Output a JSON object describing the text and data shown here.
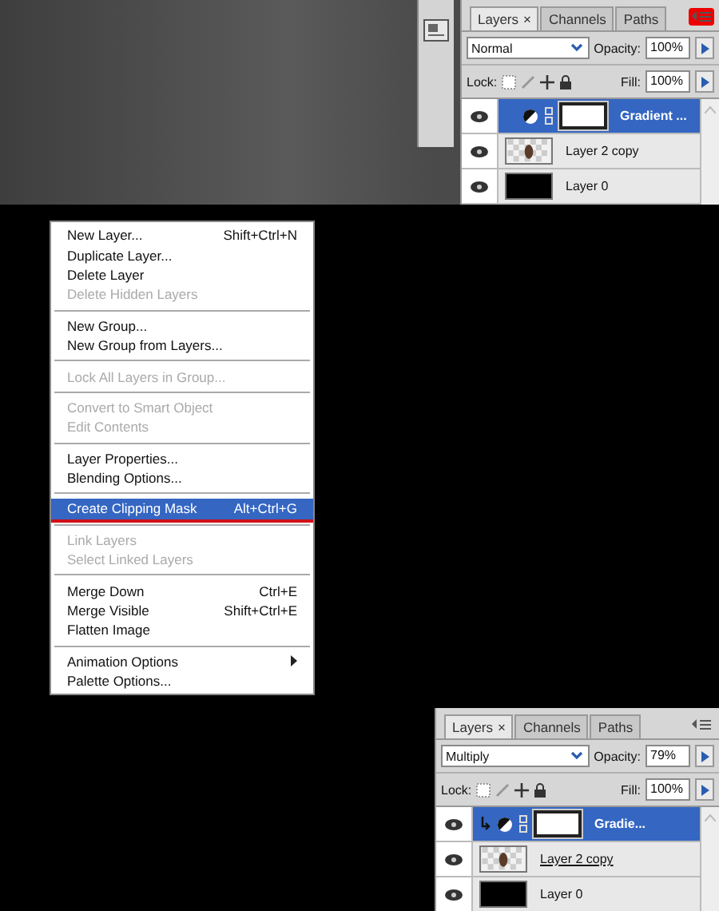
{
  "panels": [
    {
      "tabs": [
        {
          "label": "Layers",
          "selected": true,
          "close": "×"
        },
        {
          "label": "Channels",
          "selected": false
        },
        {
          "label": "Paths",
          "selected": false
        }
      ],
      "menu_button_marked": true,
      "blend_mode": "Normal",
      "opacity_label": "Opacity:",
      "opacity": "100%",
      "lock_label": "Lock:",
      "fill_label": "Fill:",
      "fill": "100%",
      "layers": [
        {
          "name": "Gradient ...",
          "kind": "adjustment",
          "selected": true,
          "clipped": false,
          "underlined": false
        },
        {
          "name": "Layer 2 copy",
          "kind": "image",
          "selected": false,
          "underlined": false
        },
        {
          "name": "Layer 0",
          "kind": "black",
          "selected": false,
          "underlined": false
        }
      ]
    },
    {
      "tabs": [
        {
          "label": "Layers",
          "selected": true,
          "close": "×"
        },
        {
          "label": "Channels",
          "selected": false
        },
        {
          "label": "Paths",
          "selected": false
        }
      ],
      "menu_button_marked": false,
      "blend_mode": "Multiply",
      "opacity_label": "Opacity:",
      "opacity": "79%",
      "lock_label": "Lock:",
      "fill_label": "Fill:",
      "fill": "100%",
      "layers": [
        {
          "name": "Gradie...",
          "kind": "adjustment",
          "selected": true,
          "clipped": true,
          "underlined": false
        },
        {
          "name": "Layer 2 copy",
          "kind": "image",
          "selected": false,
          "underlined": true
        },
        {
          "name": "Layer 0",
          "kind": "black",
          "selected": false,
          "underlined": false
        }
      ]
    }
  ],
  "context_menu": {
    "sections": [
      [
        {
          "label": "New Layer...",
          "shortcut": "Shift+Ctrl+N",
          "disabled": false,
          "selected": false
        },
        {
          "label": "Duplicate Layer...",
          "disabled": false,
          "selected": false
        },
        {
          "label": "Delete Layer",
          "disabled": false,
          "selected": false
        },
        {
          "label": "Delete Hidden Layers",
          "disabled": true,
          "selected": false
        }
      ],
      [
        {
          "label": "New Group...",
          "disabled": false,
          "selected": false
        },
        {
          "label": "New Group from Layers...",
          "disabled": false,
          "selected": false
        }
      ],
      [
        {
          "label": "Lock All Layers in Group...",
          "disabled": true,
          "selected": false
        }
      ],
      [
        {
          "label": "Convert to Smart Object",
          "disabled": true,
          "selected": false
        },
        {
          "label": "Edit Contents",
          "disabled": true,
          "selected": false
        }
      ],
      [
        {
          "label": "Layer Properties...",
          "disabled": false,
          "selected": false
        },
        {
          "label": "Blending Options...",
          "disabled": false,
          "selected": false
        }
      ],
      [
        {
          "label": "Create Clipping Mask",
          "shortcut": "Alt+Ctrl+G",
          "disabled": false,
          "selected": true
        }
      ],
      [
        {
          "label": "Link Layers",
          "disabled": true,
          "selected": false
        },
        {
          "label": "Select Linked Layers",
          "disabled": true,
          "selected": false
        }
      ],
      [
        {
          "label": "Merge Down",
          "shortcut": "Ctrl+E",
          "disabled": false,
          "selected": false
        },
        {
          "label": "Merge Visible",
          "shortcut": "Shift+Ctrl+E",
          "disabled": false,
          "selected": false
        },
        {
          "label": "Flatten Image",
          "disabled": false,
          "selected": false
        }
      ],
      [
        {
          "label": "Animation Options",
          "submenu": true,
          "disabled": false,
          "selected": false
        },
        {
          "label": "Palette Options...",
          "disabled": false,
          "selected": false
        }
      ]
    ]
  }
}
